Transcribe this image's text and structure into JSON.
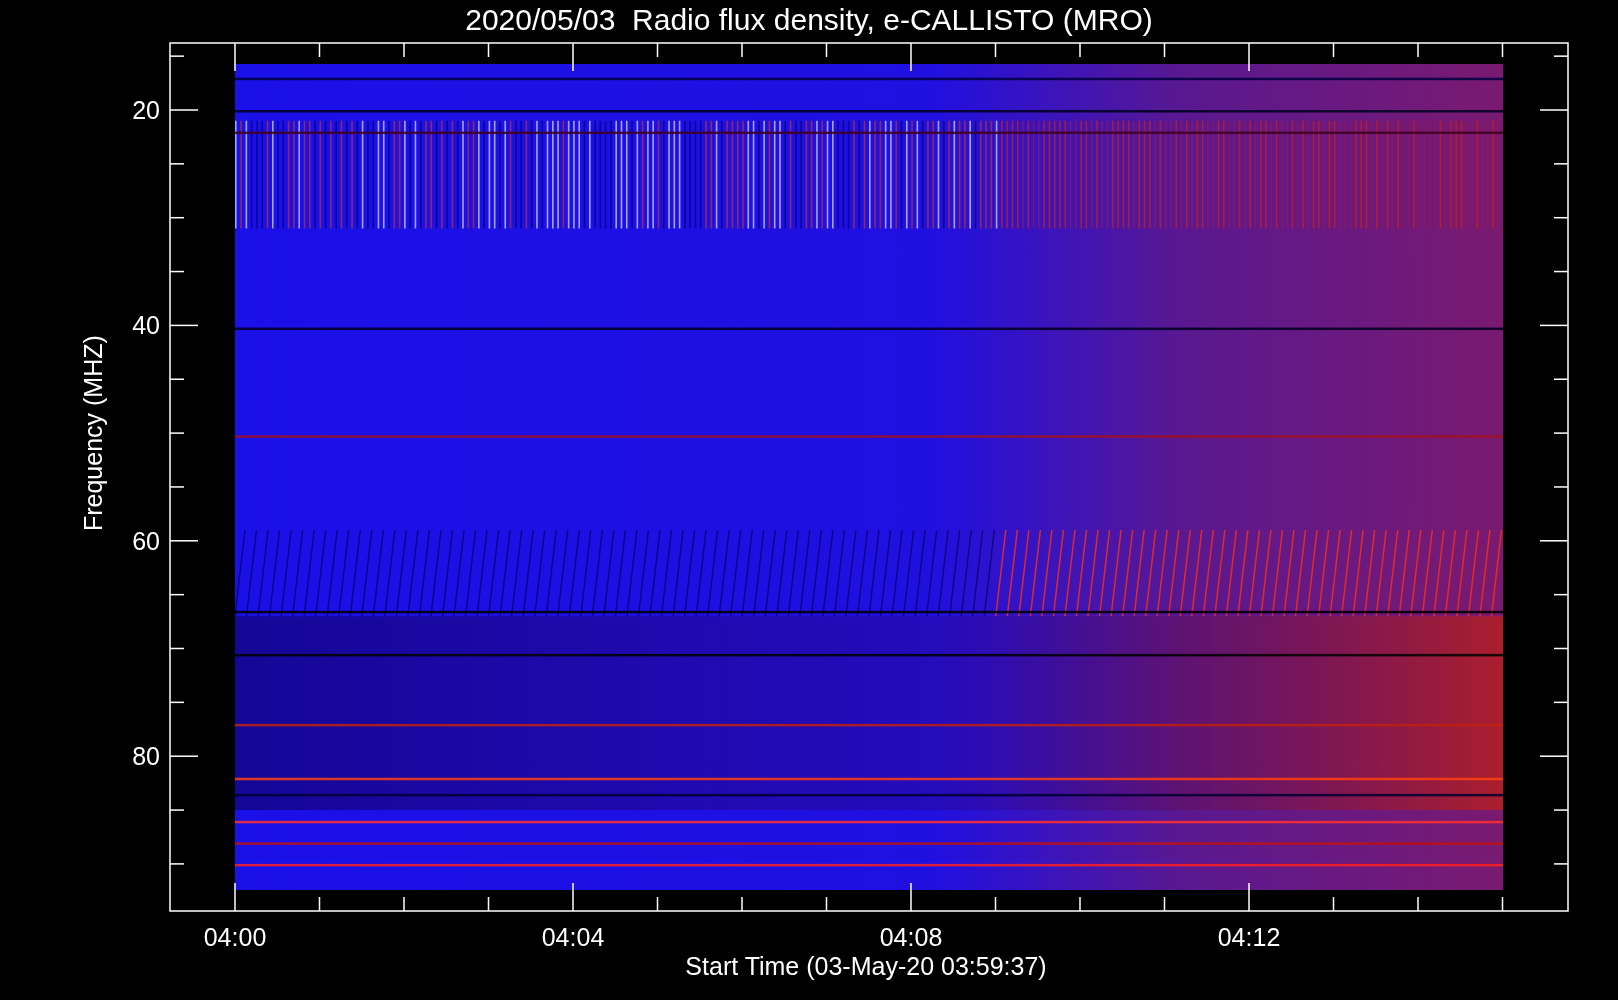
{
  "title": "2020/05/03  Radio flux density, e-CALLISTO (MRO)",
  "ylabel": "Frequency (MHZ)",
  "xlabel": "Start Time (03-May-20 03:59:37)",
  "yticks": [
    "20",
    "40",
    "60",
    "80"
  ],
  "xticks": [
    "04:00",
    "04:04",
    "04:08",
    "04:12"
  ]
}
